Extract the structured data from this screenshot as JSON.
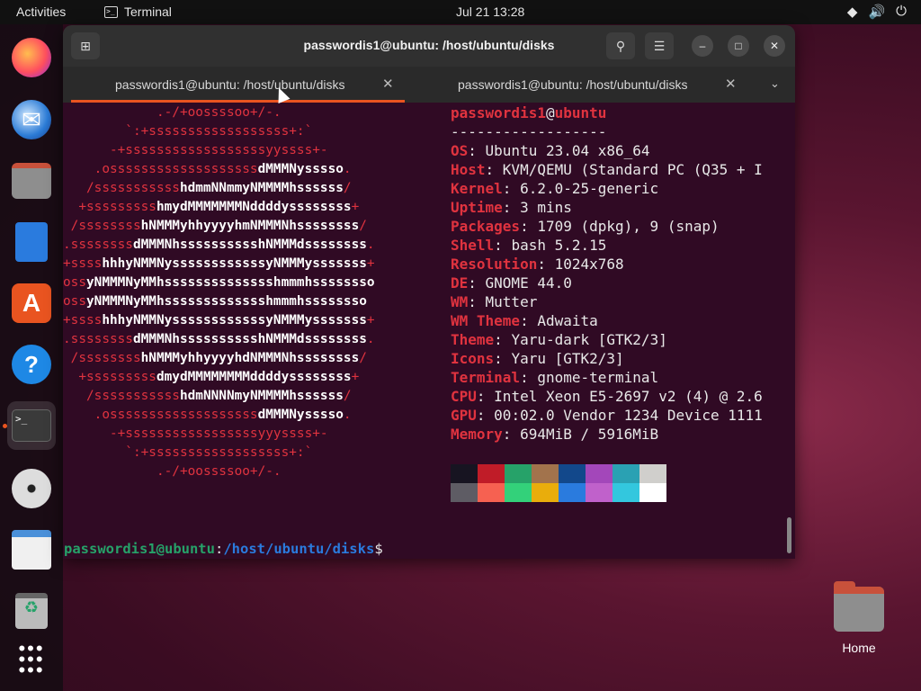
{
  "topbar": {
    "activities": "Activities",
    "app_name": "Terminal",
    "clock": "Jul 21  13:28"
  },
  "dock": {
    "items": [
      {
        "name": "firefox-icon"
      },
      {
        "name": "thunderbird-icon"
      },
      {
        "name": "files-icon"
      },
      {
        "name": "libreoffice-writer-icon"
      },
      {
        "name": "app-center-icon"
      },
      {
        "name": "help-icon"
      },
      {
        "name": "terminal-icon",
        "active": true
      },
      {
        "name": "disc-icon"
      },
      {
        "name": "text-editor-icon"
      },
      {
        "name": "trash-icon"
      },
      {
        "name": "show-apps-icon"
      }
    ]
  },
  "window": {
    "title": "passwordis1@ubuntu: /host/ubuntu/disks",
    "tabs": [
      {
        "label": "passwordis1@ubuntu: /host/ubuntu/disks",
        "active": true
      },
      {
        "label": "passwordis1@ubuntu: /host/ubuntu/disks",
        "active": false
      }
    ]
  },
  "logo_lines": [
    "            .-/+oossssoo+/-.",
    "        `:+ssssssssssssssssss+:`",
    "      -+ssssssssssssssssssyyssss+-",
    "    .osssssssssssssssssssdMMMNysssso.",
    "   /ssssssssssshdmmNNmmyNMMMMhssssss/",
    "  +ssssssssshmydMMMMMMMNddddyssssssss+",
    " /sssssssshNMMMyhhyyyyhmNMMMNhssssssss/",
    ".ssssssssdMMMNhsssssssssshNMMMdssssssss.",
    "+sssshhhyNMMNyssssssssssssyNMMMysssssss+",
    "ossyNMMMNyMMhsssssssssssssshmmmhssssssso",
    "ossyNMMMNyMMhssssssssssssshmmmhssssssso",
    "+sssshhhyNMMNyssssssssssssyNMMMysssssss+",
    ".ssssssssdMMMNhsssssssssshNMMMdssssssss.",
    " /sssssssshNMMMyhhyyyyhdNMMMNhssssssss/",
    "  +sssssssssdmydMMMMMMMMddddyssssssss+",
    "   /ssssssssssshdmNNNNmyNMMMMhssssss/",
    "    .osssssssssssssssssssdMMMNysssso.",
    "      -+sssssssssssssssssyyyssss+-",
    "        `:+ssssssssssssssssss+:`",
    "            .-/+oossssoo+/-."
  ],
  "info": {
    "user": "passwordis1",
    "at": "@",
    "host": "ubuntu",
    "separator": "------------------",
    "rows": [
      {
        "label": "OS",
        "value": "Ubuntu 23.04 x86_64"
      },
      {
        "label": "Host",
        "value": "KVM/QEMU (Standard PC (Q35 + I"
      },
      {
        "label": "Kernel",
        "value": "6.2.0-25-generic"
      },
      {
        "label": "Uptime",
        "value": "3 mins"
      },
      {
        "label": "Packages",
        "value": "1709 (dpkg), 9 (snap)"
      },
      {
        "label": "Shell",
        "value": "bash 5.2.15"
      },
      {
        "label": "Resolution",
        "value": "1024x768"
      },
      {
        "label": "DE",
        "value": "GNOME 44.0"
      },
      {
        "label": "WM",
        "value": "Mutter"
      },
      {
        "label": "WM Theme",
        "value": "Adwaita"
      },
      {
        "label": "Theme",
        "value": "Yaru-dark [GTK2/3]"
      },
      {
        "label": "Icons",
        "value": "Yaru [GTK2/3]"
      },
      {
        "label": "Terminal",
        "value": "gnome-terminal"
      },
      {
        "label": "CPU",
        "value": "Intel Xeon E5-2697 v2 (4) @ 2.6"
      },
      {
        "label": "GPU",
        "value": "00:02.0 Vendor 1234 Device 1111"
      },
      {
        "label": "Memory",
        "value": "694MiB / 5916MiB"
      }
    ]
  },
  "palette": {
    "row1": [
      "#171421",
      "#c01c28",
      "#26a269",
      "#a2734c",
      "#12488b",
      "#a347ba",
      "#2aa1b3",
      "#d0cfcc"
    ],
    "row2": [
      "#5e5c64",
      "#f66151",
      "#33d17a",
      "#e9ad0c",
      "#2a7bde",
      "#c061cb",
      "#33c7de",
      "#ffffff"
    ]
  },
  "prompt": {
    "user_host": "passwordis1@ubuntu",
    "colon": ":",
    "path": "/host/ubuntu/disks",
    "symbol": "$"
  },
  "desktop": {
    "home_label": "Home"
  }
}
